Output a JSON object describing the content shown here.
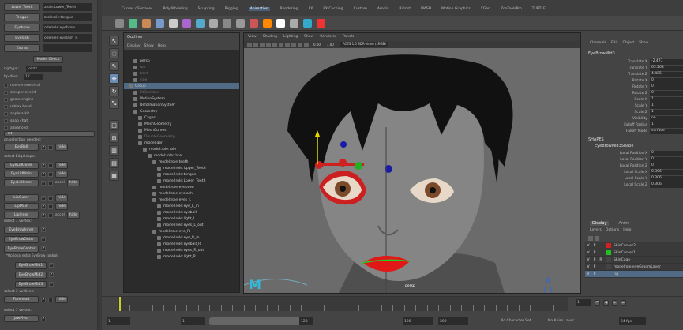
{
  "left_panel": {
    "top_rows": [
      {
        "btn": "Lower Teeth",
        "field": "zrole:Lower_Teeth"
      },
      {
        "btn": "Tongue",
        "field": "zrole:ole:tongue"
      },
      {
        "btn": "Eyebrow",
        "field": "odelrole:eyebrow"
      },
      {
        "btn": "Eyelash",
        "field": "odelrole:eyelash_R"
      },
      {
        "btn": "Extras",
        "field": ""
      }
    ],
    "model_check": "Model Check",
    "rig_type_label": "rig type:",
    "rig_type_value": "Joints",
    "bp_div_label": "bp-divs:",
    "bp_div_value": "12",
    "options": [
      "non-symmetrical",
      "steeper eyelid",
      "game engine",
      "roblox head",
      "apple arkit",
      "snap chat",
      "advanced"
    ],
    "fit_label": "Fit",
    "on_sel_label": "on selection needed:",
    "eyeball": "EyeBall",
    "hide": "hide",
    "select_edges_label": "select Edgeloops:",
    "edge_buttons": [
      {
        "label": "EyeLidOuter",
        "extra": ""
      },
      {
        "label": "EyeLidMain",
        "extra": ""
      },
      {
        "label": "EyeLidInner",
        "extra": "accel"
      },
      {
        "label": "LipOuter",
        "extra": ""
      },
      {
        "label": "LipMain",
        "extra": ""
      },
      {
        "label": "LipInner",
        "extra": "accel"
      }
    ],
    "vertex_label": "select 1 vertex:",
    "brow_buttons": [
      "EyeBrowInner",
      "EyeBrowOuter",
      "EyeBrowCenter"
    ],
    "optional_label": "*Optional extra EyeBrow controls",
    "brow_mid": [
      "EyeBrowMid1",
      "EyeBrowMid2",
      "EyeBrowMid3"
    ],
    "three_verts_label": "select 3 vertices:",
    "forehead": "Forehead",
    "one_vert_label": "select 1 vertex:",
    "jaw_pivot": "JawPivot"
  },
  "menus": [
    "Curves / Surfaces",
    "Poly Modeling",
    "Sculpting",
    "Rigging",
    "Animation",
    "Rendering",
    "FX",
    "FX Caching",
    "Custom",
    "Arnold",
    "Bifrost",
    "MASH",
    "Motion Graphics",
    "XGen",
    "ZooToolsPro",
    "TURTLE"
  ],
  "active_menu": "Animation",
  "outliner": {
    "title": "Outliner",
    "menu": [
      "Display",
      "Show",
      "Help"
    ],
    "items": [
      {
        "label": "persp",
        "d": 1,
        "dim": false
      },
      {
        "label": "top",
        "d": 1,
        "dim": true
      },
      {
        "label": "front",
        "d": 1,
        "dim": true
      },
      {
        "label": "side",
        "d": 1,
        "dim": true
      },
      {
        "label": "Group",
        "d": 0,
        "dim": false,
        "sel": true
      },
      {
        "label": "FitSkeleton",
        "d": 1,
        "dim": true
      },
      {
        "label": "MotionSystem",
        "d": 1,
        "dim": false
      },
      {
        "label": "DeformationSystem",
        "d": 1,
        "dim": false
      },
      {
        "label": "Geometry",
        "d": 1,
        "dim": false
      },
      {
        "label": "Cages",
        "d": 2,
        "dim": false
      },
      {
        "label": "MeshGeometry",
        "d": 2,
        "dim": false
      },
      {
        "label": "MeshCurves",
        "d": 2,
        "dim": false
      },
      {
        "label": "DoubleGeometry",
        "d": 2,
        "dim": true
      },
      {
        "label": "model:gen",
        "d": 2,
        "dim": false
      },
      {
        "label": "model:role:role",
        "d": 3,
        "dim": false
      },
      {
        "label": "model:role:face",
        "d": 4,
        "dim": false
      },
      {
        "label": "model:role:teeth",
        "d": 5,
        "dim": false
      },
      {
        "label": "model:role:Upper_Teeth",
        "d": 6,
        "dim": false
      },
      {
        "label": "model:role:tongue",
        "d": 6,
        "dim": false
      },
      {
        "label": "model:role:Lower_Teeth",
        "d": 6,
        "dim": false
      },
      {
        "label": "model:role:eyebrow",
        "d": 5,
        "dim": false
      },
      {
        "label": "model:role:eyelash",
        "d": 5,
        "dim": false
      },
      {
        "label": "model:role:eyes_L",
        "d": 5,
        "dim": false
      },
      {
        "label": "model:role:eye_L_in",
        "d": 6,
        "dim": false
      },
      {
        "label": "model:role:eyeball",
        "d": 6,
        "dim": false
      },
      {
        "label": "model:role:light_L",
        "d": 6,
        "dim": false
      },
      {
        "label": "model:role:eyes_L_out",
        "d": 6,
        "dim": false
      },
      {
        "label": "model:role:eye_R",
        "d": 5,
        "dim": false
      },
      {
        "label": "model:role:eye_R_in",
        "d": 6,
        "dim": false
      },
      {
        "label": "model:role:eyeball_R",
        "d": 6,
        "dim": false
      },
      {
        "label": "model:role:eyes_R_out",
        "d": 6,
        "dim": false
      },
      {
        "label": "model:role:light_R",
        "d": 6,
        "dim": false
      }
    ]
  },
  "viewport": {
    "menu": [
      "View",
      "Shading",
      "Lighting",
      "Show",
      "Renderer",
      "Panels"
    ],
    "camera_label": "persp",
    "colorspace": "ACES 1.0 SDR-video (sRGB)",
    "exposure": "0.00",
    "gamma": "1.00"
  },
  "channel_box": {
    "menu": [
      "Channels",
      "Edit",
      "Object",
      "Show"
    ],
    "object": "EyeBrowMid3",
    "channels": [
      {
        "name": "Translate X",
        "value": "-2.473"
      },
      {
        "name": "Translate Y",
        "value": "65.263"
      },
      {
        "name": "Translate Z",
        "value": "4.485"
      },
      {
        "name": "Rotate X",
        "value": "0"
      },
      {
        "name": "Rotate Y",
        "value": "0"
      },
      {
        "name": "Rotate Z",
        "value": "0"
      },
      {
        "name": "Scale X",
        "value": "1"
      },
      {
        "name": "Scale Y",
        "value": "1"
      },
      {
        "name": "Scale Z",
        "value": "1"
      },
      {
        "name": "Visibility",
        "value": "on"
      },
      {
        "name": "Falloff Radius",
        "value": "1"
      },
      {
        "name": "Falloff Mode",
        "value": "surface"
      }
    ],
    "shapes_label": "SHAPES",
    "shape_name": "EyeBrowMid3Shape",
    "shape_channels": [
      {
        "name": "Local Position X",
        "value": "0"
      },
      {
        "name": "Local Position Y",
        "value": "0"
      },
      {
        "name": "Local Position Z",
        "value": "0"
      },
      {
        "name": "Local Scale X",
        "value": "0.306"
      },
      {
        "name": "Local Scale Y",
        "value": "0.306"
      },
      {
        "name": "Local Scale Z",
        "value": "0.306"
      }
    ]
  },
  "layers": {
    "tabs": [
      "Display",
      "Anim"
    ],
    "menu": [
      "Layers",
      "Options",
      "Help"
    ],
    "items": [
      {
        "name": "SkinCurves2",
        "color": "#d42020",
        "sel": false,
        "r": ""
      },
      {
        "name": "SkinCurves1",
        "color": "#20c020",
        "sel": false,
        "r": ""
      },
      {
        "name": "SkinCage",
        "color": "#444444",
        "sel": false,
        "r": "R"
      },
      {
        "name": "modelrole:eyeGroomLayer",
        "color": "#444444",
        "sel": false,
        "r": ""
      },
      {
        "name": "rig",
        "color": "#516a85",
        "sel": true,
        "r": ""
      }
    ]
  },
  "timeline": {
    "ticks": [
      "1",
      "",
      "",
      "",
      "",
      "",
      "",
      "",
      "",
      "",
      "",
      "",
      "",
      "",
      "",
      "",
      "",
      "",
      "",
      "",
      "",
      "",
      "",
      "",
      "",
      "",
      "",
      "",
      "",
      "",
      "",
      "",
      "",
      "",
      "",
      "",
      "",
      "",
      "",
      ""
    ],
    "current_frame": "1"
  },
  "range": {
    "start": "1",
    "start2": "1",
    "end_inner": "120",
    "end_inner2": "120",
    "end_outer": "200",
    "char_set": "No Character Set",
    "anim_layer": "No Anim Layer",
    "fps": "24 fps"
  }
}
